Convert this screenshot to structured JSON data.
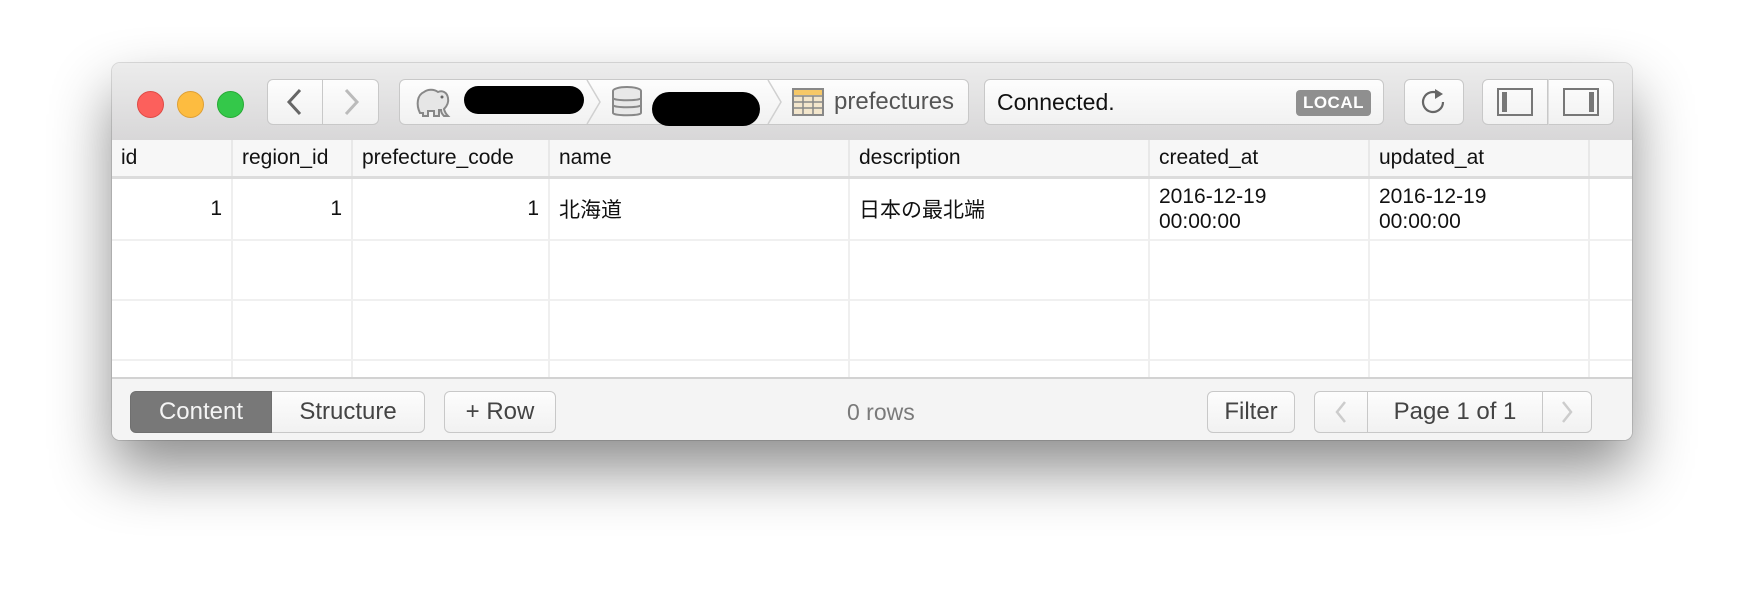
{
  "window": {
    "traffic_lights": [
      "close",
      "minimize",
      "zoom"
    ]
  },
  "toolbar": {
    "back_icon": "chevron-left-icon",
    "forward_icon": "chevron-right-icon",
    "breadcrumb": {
      "connection": {
        "icon": "postgres-elephant-icon",
        "label": "[redacted]"
      },
      "database": {
        "icon": "database-icon",
        "label": "[redacted]"
      },
      "table": {
        "icon": "table-icon",
        "label": "prefectures"
      }
    },
    "status": {
      "text": "Connected.",
      "badge": "LOCAL"
    },
    "refresh_icon": "refresh-icon",
    "left_panel_icon": "left-sidebar-icon",
    "right_panel_icon": "right-sidebar-icon"
  },
  "table": {
    "columns": [
      "id",
      "region_id",
      "prefecture_code",
      "name",
      "description",
      "created_at",
      "updated_at"
    ],
    "rows": [
      {
        "id": "1",
        "region_id": "1",
        "prefecture_code": "1",
        "name": "北海道",
        "description": "日本の最北端",
        "created_at": [
          "2016-12-19",
          "00:00:00"
        ],
        "updated_at": [
          "2016-12-19",
          "00:00:00"
        ]
      }
    ]
  },
  "footer": {
    "tabs": [
      {
        "label": "Content",
        "active": true
      },
      {
        "label": "Structure",
        "active": false
      }
    ],
    "add_row_label": "+ Row",
    "row_count": "0 rows",
    "filter_label": "Filter",
    "pagination": {
      "label": "Page 1 of 1",
      "current": 1,
      "total": 1
    }
  }
}
